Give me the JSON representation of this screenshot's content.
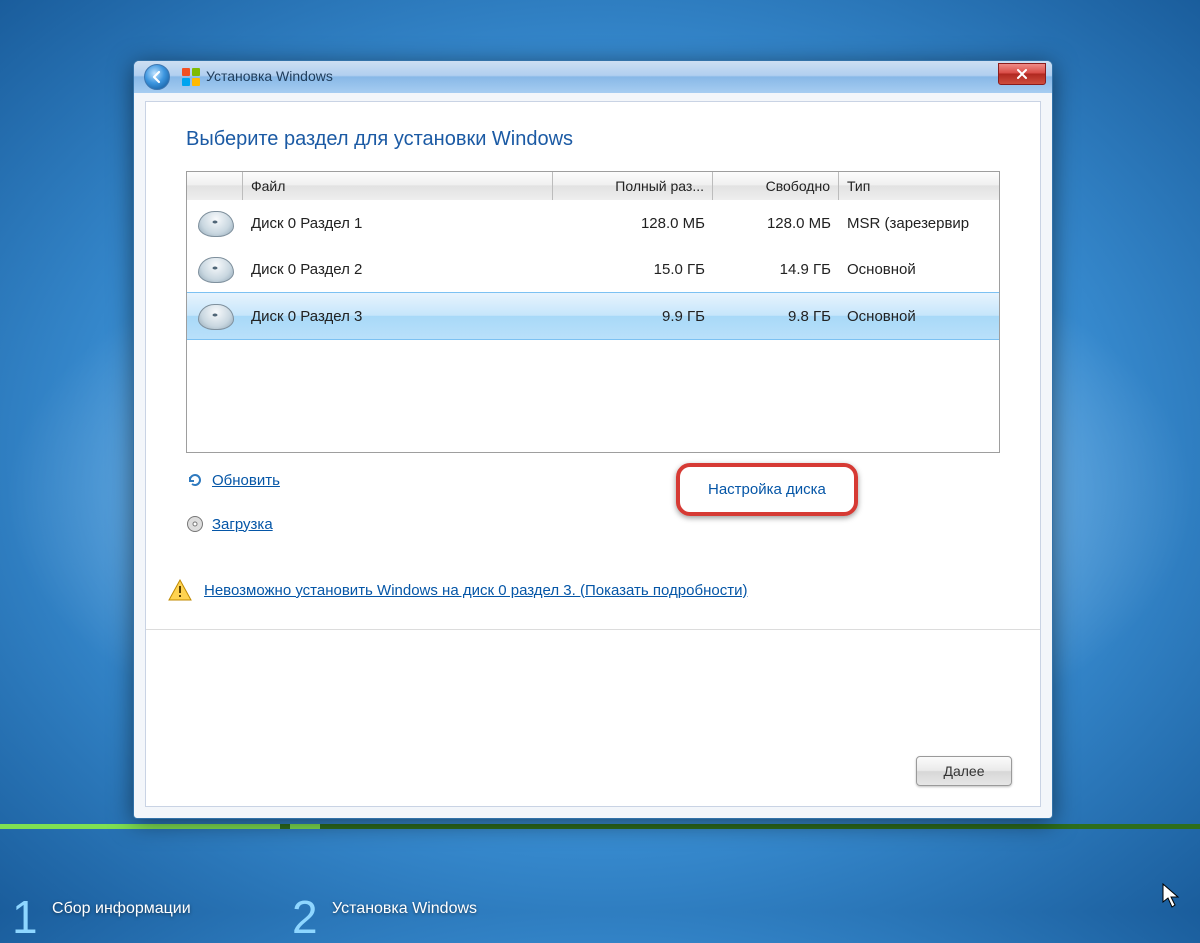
{
  "titlebar": {
    "title": "Установка Windows"
  },
  "heading": "Выберите раздел для установки Windows",
  "table": {
    "headers": {
      "name": "Файл",
      "total": "Полный раз...",
      "free": "Свободно",
      "type": "Тип"
    },
    "rows": [
      {
        "name": "Диск 0 Раздел 1",
        "total": "128.0 МБ",
        "free": "128.0 МБ",
        "type": "MSR (зарезервир",
        "selected": false
      },
      {
        "name": "Диск 0 Раздел 2",
        "total": "15.0 ГБ",
        "free": "14.9 ГБ",
        "type": "Основной",
        "selected": false
      },
      {
        "name": "Диск 0 Раздел 3",
        "total": "9.9 ГБ",
        "free": "9.8 ГБ",
        "type": "Основной",
        "selected": true
      }
    ]
  },
  "tools": {
    "refresh": "Обновить",
    "load": "Загрузка",
    "disk_setup": "Настройка диска"
  },
  "warning": "Невозможно установить Windows на диск 0 раздел 3. (Показать подробности)",
  "buttons": {
    "next": "Далее"
  },
  "progress": {
    "step1": "Сбор информации",
    "step2": "Установка Windows"
  }
}
